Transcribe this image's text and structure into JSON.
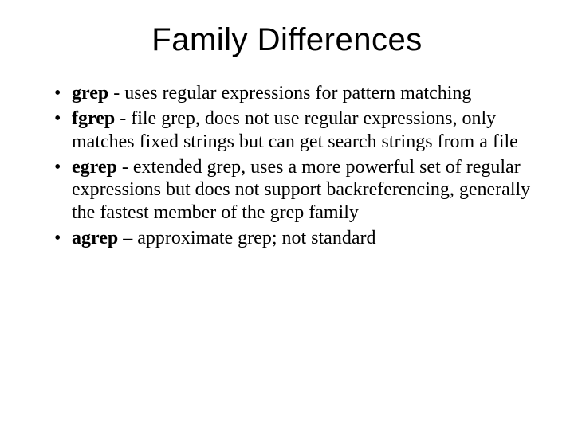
{
  "title": "Family Differences",
  "bullets": [
    {
      "term": "grep",
      "sep": " - ",
      "desc": "uses regular expressions for pattern matching"
    },
    {
      "term": "fgrep",
      "sep": " - ",
      "desc": "file grep, does not use regular expressions, only matches fixed strings but can get search strings from a file"
    },
    {
      "term": "egrep",
      "sep": " - ",
      "desc": "extended grep, uses a more powerful set of regular expressions but does not support backreferencing, generally the fastest member of the grep family"
    },
    {
      "term": "agrep",
      "sep": " – ",
      "desc": "approximate grep; not standard"
    }
  ]
}
